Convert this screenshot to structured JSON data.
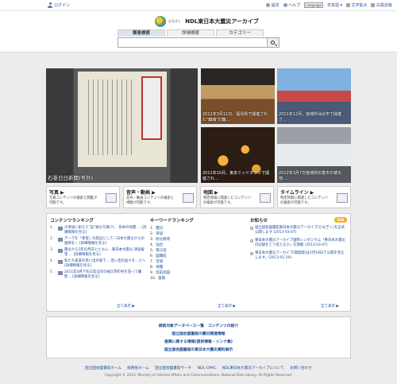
{
  "topbar": {
    "login": "ログイン",
    "settings": "設定",
    "help": "ヘルプ",
    "language_box": "Language",
    "language": "日本語",
    "font_size": "文字拡大",
    "contrast": "白黒反転"
  },
  "header": {
    "logo_sub": "ひなぎく",
    "logo_text": "NDL東日本大震災アーカイブ",
    "tabs": [
      "簡易検索",
      "詳細検索",
      "カテゴリー"
    ],
    "search_placeholder": ""
  },
  "hero": {
    "main_caption": "石巻日日新聞(号外)",
    "main_paper_title": "石巻日日新聞",
    "tile_a_caption": "2012年3月11日、福島県で開催された\"鎮魂\"灯籠…",
    "tile_b_caption": "2011年12月、宮城県仙台市で開催さ…",
    "tile_c_caption": "2011年10月、東京ミッドタウンで開催され…",
    "tile_d_caption": "2012年3月7日宮城県石巻市の被災地…"
  },
  "features": [
    {
      "title": "写真 ▶",
      "desc": "写真コンテンツの検索と閲覧が可能です。"
    },
    {
      "title": "音声・動画 ▶",
      "desc": "音声・動画コンテンツの検索と視聴が可能です。"
    },
    {
      "title": "地図 ▶",
      "desc": "特定地域に関連したコンテンツの検索が可能です。"
    },
    {
      "title": "タイムライン ▶",
      "desc": "特定時期に関連したコンテンツの検索が可能です。"
    }
  ],
  "content_ranking": {
    "title": "コンテンツランキング",
    "items": [
      {
        "num": "1.",
        "text": "大津波に耐えた\"証\"被災写真(?)… 日本の地震 … [詳細情報を見る]"
      },
      {
        "num": "2.",
        "text": "テーマを「希望」の船出として—日本大震災からの復興を— [詳細情報を見る]"
      },
      {
        "num": "3.",
        "text": "震災から1年の月日とともに…東日本大震災 津波被害 … [詳細情報を見る]"
      },
      {
        "num": "4.",
        "text": "私たち家族の思い出の家で… 思い出の品々を…とへ [詳細情報を見る]"
      },
      {
        "num": "5.",
        "text": "2011年4月下旬三陸沿岸の被災市町村を巡って撮影… [詳細情報を見る]"
      }
    ],
    "more": "全て表示 ▶"
  },
  "keyword_ranking": {
    "title": "キーワードランキング",
    "items": [
      {
        "num": "1.",
        "text": "震災"
      },
      {
        "num": "2.",
        "text": "津波"
      },
      {
        "num": "3.",
        "text": "防災教育"
      },
      {
        "num": "4.",
        "text": "仙台"
      },
      {
        "num": "5.",
        "text": "南三陸"
      },
      {
        "num": "6.",
        "text": "図書館"
      },
      {
        "num": "7.",
        "text": "宮城"
      },
      {
        "num": "8.",
        "text": "地震"
      },
      {
        "num": "9.",
        "text": "陸前高田"
      },
      {
        "num": "10.",
        "text": "復興"
      }
    ],
    "more": "全て表示 ▶"
  },
  "news": {
    "title": "お知らせ",
    "rss": "RSS",
    "items": [
      {
        "text": "国立国会図書館東日本大震災アーカイブ(ひなぎく)を正式公開します (2013-03-07)"
      },
      {
        "text": "東日本大震災アーカイブ国際シンポジウム「東日本大震災の記録をどう伝えるか」を開催 (2013-03-07)"
      },
      {
        "text": "東日本大震災アーカイブ(開発版)は1月18日で公開を停止します。(2013-01-29)"
      }
    ],
    "more": "全て表示 ▶"
  },
  "linkbox": {
    "lines": [
      "検索対象データベース一覧　コンテンツの紹介",
      "国立国会図書館の震災関連情報",
      "復興に関する情報(提供情報・リンク集)",
      "国立国会図書館の東日本大震災資料展示"
    ]
  },
  "footer": {
    "links": [
      "国立国会図書館ホーム",
      "総務省ホーム",
      "国立国会図書館サーチ",
      "NDL-OPAC",
      "NDL東日本大震災アーカイブについて",
      "お問い合わせ"
    ],
    "copyright": "Copyright © 2013- Ministry of Internal Affairs and Communications, National Diet Library. All Rights Reserved."
  }
}
